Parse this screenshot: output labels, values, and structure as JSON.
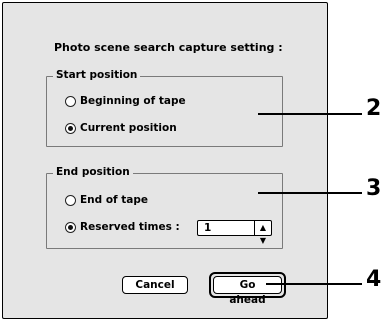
{
  "dialog": {
    "title": "Photo scene search capture setting :",
    "start_group": {
      "legend": "Start position",
      "options": [
        {
          "label": "Beginning of tape",
          "selected": false
        },
        {
          "label": "Current position",
          "selected": true
        }
      ]
    },
    "end_group": {
      "legend": "End position",
      "options": [
        {
          "label": "End of tape",
          "selected": false
        },
        {
          "label": "Reserved times :",
          "selected": true
        }
      ],
      "reserved_times_value": "1",
      "stepper_icon": "up-down-arrows-icon"
    },
    "buttons": {
      "cancel": "Cancel",
      "go_ahead": "Go ahead"
    }
  },
  "callouts": [
    "2",
    "3",
    "4"
  ]
}
